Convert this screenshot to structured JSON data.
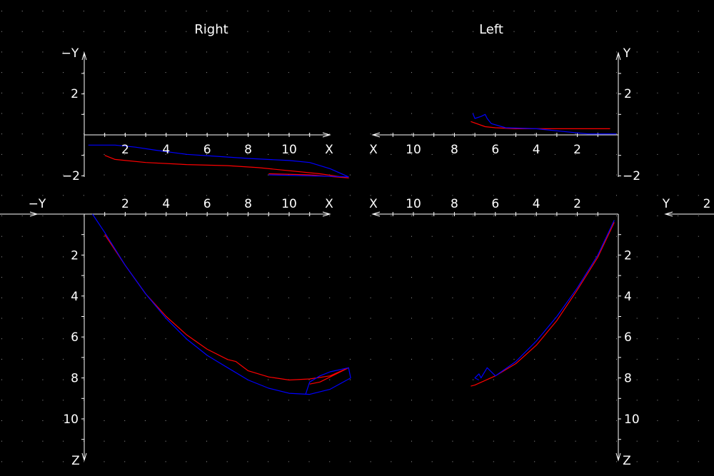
{
  "colors": {
    "background": "#000000",
    "axes": "#ffffff",
    "grid": "#9a9a9a",
    "series_a": "#ff0000",
    "series_b": "#0000ff"
  },
  "chart_data": [
    {
      "id": "right-xy",
      "type": "line",
      "title": "Right",
      "xlabel": "X",
      "ylabel": "−Y",
      "xlim": [
        0,
        12
      ],
      "ylim": [
        -2,
        3.5
      ],
      "xticks": [
        "2",
        "4",
        "6",
        "8",
        "10"
      ],
      "yticks": [
        "2",
        "−2"
      ],
      "series": [
        {
          "color": "#ff0000",
          "points": [
            [
              1.0,
              -1.0
            ],
            [
              1.5,
              -1.2
            ],
            [
              3,
              -1.35
            ],
            [
              5,
              -1.45
            ],
            [
              7,
              -1.5
            ],
            [
              8.5,
              -1.6
            ],
            [
              10,
              -1.75
            ],
            [
              11.5,
              -1.9
            ],
            [
              12.9,
              -2.1
            ],
            [
              11,
              -1.95
            ],
            [
              9,
              -1.9
            ]
          ]
        },
        {
          "color": "#0000ff",
          "points": [
            [
              0.2,
              -0.5
            ],
            [
              1.5,
              -0.5
            ],
            [
              2.5,
              -0.6
            ],
            [
              3.5,
              -0.75
            ],
            [
              5,
              -0.95
            ],
            [
              6.5,
              -1.05
            ],
            [
              8,
              -1.15
            ],
            [
              10,
              -1.25
            ],
            [
              11,
              -1.35
            ],
            [
              12,
              -1.65
            ],
            [
              12.9,
              -2.05
            ],
            [
              11,
              -2.0
            ],
            [
              9,
              -1.95
            ]
          ]
        }
      ]
    },
    {
      "id": "left-xy",
      "type": "line",
      "title": "Left",
      "xlabel": "X",
      "ylabel": "Y",
      "xlim": [
        12,
        0
      ],
      "ylim": [
        -2,
        3.5
      ],
      "xticks": [
        "10",
        "8",
        "6",
        "4",
        "2"
      ],
      "yticks": [
        "2",
        "−2"
      ],
      "series": [
        {
          "color": "#ff0000",
          "points": [
            [
              7.2,
              0.65
            ],
            [
              6.5,
              0.4
            ],
            [
              6,
              0.35
            ],
            [
              5,
              0.3
            ],
            [
              3,
              0.3
            ],
            [
              1,
              0.3
            ],
            [
              0.4,
              0.3
            ]
          ]
        },
        {
          "color": "#0000ff",
          "points": [
            [
              7.1,
              1.05
            ],
            [
              7.0,
              0.8
            ],
            [
              6.7,
              0.9
            ],
            [
              6.5,
              1.0
            ],
            [
              6.4,
              0.8
            ],
            [
              6.2,
              0.55
            ],
            [
              5.5,
              0.35
            ],
            [
              4,
              0.3
            ],
            [
              3,
              0.2
            ],
            [
              1.5,
              0.05
            ],
            [
              0.1,
              0.05
            ]
          ]
        }
      ]
    },
    {
      "id": "right-xz",
      "type": "line",
      "xlabel": "X",
      "ylabel": "Z",
      "xlim": [
        0,
        12
      ],
      "ylim": [
        0,
        12
      ],
      "xticks": [
        "2",
        "4",
        "6",
        "8",
        "10"
      ],
      "yticks": [
        "2",
        "4",
        "6",
        "8",
        "10"
      ],
      "series": [
        {
          "color": "#ff0000",
          "points": [
            [
              1.0,
              1.0
            ],
            [
              2,
              2.5
            ],
            [
              3,
              3.9
            ],
            [
              4,
              5.0
            ],
            [
              5,
              5.9
            ],
            [
              6,
              6.6
            ],
            [
              7,
              7.1
            ],
            [
              7.4,
              7.2
            ],
            [
              8,
              7.65
            ],
            [
              9,
              7.95
            ],
            [
              10,
              8.1
            ],
            [
              11,
              8.05
            ],
            [
              12,
              7.9
            ],
            [
              12.9,
              7.5
            ],
            [
              11.5,
              8.2
            ],
            [
              11,
              8.3
            ]
          ]
        },
        {
          "color": "#0000ff",
          "points": [
            [
              0.4,
              0.0
            ],
            [
              1,
              0.9
            ],
            [
              2,
              2.5
            ],
            [
              3,
              3.9
            ],
            [
              4,
              5.1
            ],
            [
              5,
              6.1
            ],
            [
              6,
              6.9
            ],
            [
              7,
              7.5
            ],
            [
              8,
              8.1
            ],
            [
              9,
              8.5
            ],
            [
              10,
              8.75
            ],
            [
              11,
              8.8
            ],
            [
              12,
              8.55
            ],
            [
              13,
              8.0
            ],
            [
              12.9,
              7.5
            ],
            [
              12,
              7.7
            ],
            [
              11.5,
              7.9
            ],
            [
              11,
              8.2
            ],
            [
              10.8,
              8.8
            ]
          ]
        }
      ]
    },
    {
      "id": "left-yz",
      "type": "line",
      "xlabel": "X",
      "ylabel": "Z",
      "side_label": "Y",
      "side_tick": "2",
      "xlim": [
        12,
        0
      ],
      "ylim": [
        0,
        12
      ],
      "xticks": [
        "10",
        "8",
        "6",
        "4",
        "2"
      ],
      "yticks": [
        "2",
        "4",
        "6",
        "8",
        "10"
      ],
      "series": [
        {
          "color": "#ff0000",
          "points": [
            [
              0.2,
              0.4
            ],
            [
              1,
              2.1
            ],
            [
              2,
              3.7
            ],
            [
              3,
              5.2
            ],
            [
              4,
              6.4
            ],
            [
              5,
              7.3
            ],
            [
              5.5,
              7.6
            ],
            [
              6,
              7.9
            ],
            [
              7,
              8.35
            ],
            [
              7.2,
              8.4
            ]
          ]
        },
        {
          "color": "#0000ff",
          "points": [
            [
              0.2,
              0.3
            ],
            [
              1,
              2.0
            ],
            [
              2,
              3.6
            ],
            [
              3,
              5.0
            ],
            [
              4,
              6.2
            ],
            [
              5,
              7.2
            ],
            [
              6,
              7.9
            ],
            [
              6.4,
              7.5
            ],
            [
              6.7,
              8.0
            ],
            [
              6.8,
              7.8
            ],
            [
              7.0,
              8.0
            ],
            [
              6.8,
              8.1
            ]
          ]
        }
      ]
    }
  ]
}
